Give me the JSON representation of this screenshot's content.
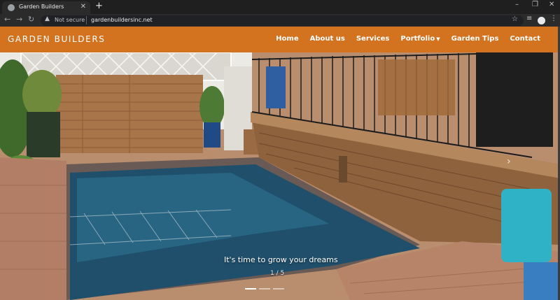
{
  "browser": {
    "tab_title": "Garden Builders",
    "tab_close": "✕",
    "new_tab": "+",
    "security_label": "Not secure",
    "url": "gardenbuildersinc.net",
    "icons": [
      "back-arrow-icon",
      "forward-arrow-icon",
      "reload-icon",
      "warning-icon",
      "star-icon",
      "reading-list-icon",
      "profile-icon",
      "menu-icon"
    ]
  },
  "site": {
    "brand": "GARDEN BUILDERS",
    "nav": [
      {
        "label": "Home"
      },
      {
        "label": "About us"
      },
      {
        "label": "Services"
      },
      {
        "label": "Portfolio"
      },
      {
        "label": "Garden Tips"
      },
      {
        "label": "Contact"
      }
    ],
    "accent_color": "#d4731f"
  },
  "carousel": {
    "caption": "It's time to grow your dreams",
    "counter": "1 / 5",
    "slides": 5,
    "active_slide": 1
  }
}
